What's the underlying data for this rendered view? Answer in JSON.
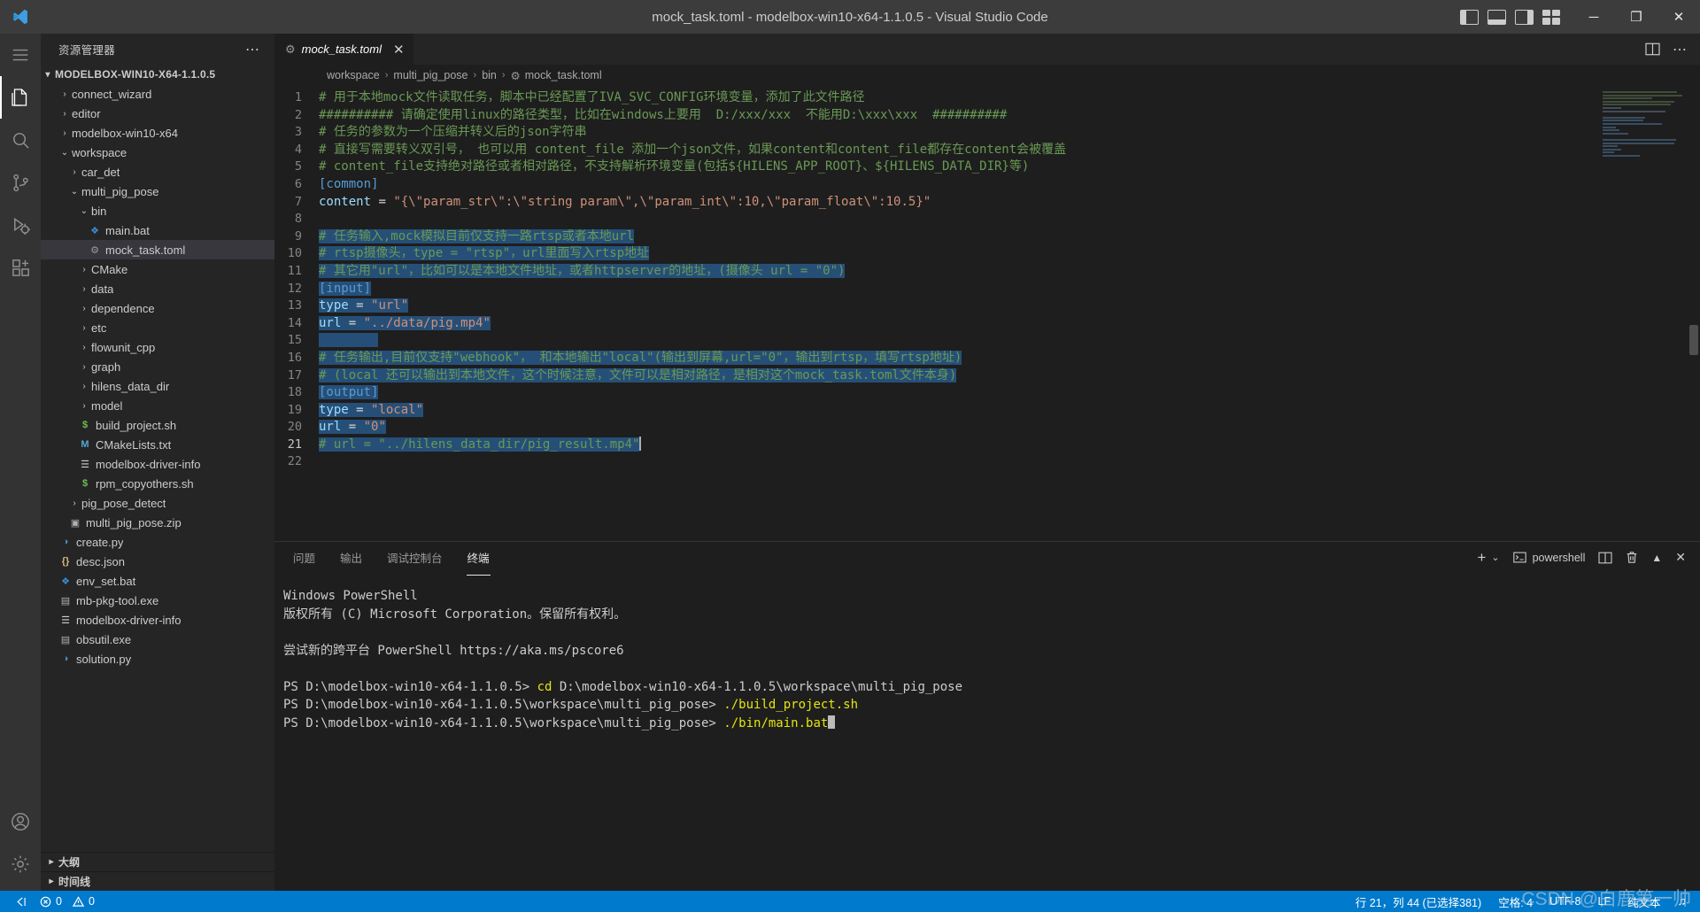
{
  "titlebar": {
    "title": "mock_task.toml - modelbox-win10-x64-1.1.0.5 - Visual Studio Code",
    "layout_icons": [
      "panel-left-icon",
      "panel-bottom-icon",
      "panel-right-icon",
      "customize-layout-icon"
    ],
    "window_buttons": {
      "minimize": "─",
      "maximize": "❐",
      "close": "✕"
    }
  },
  "activitybar": {
    "items": [
      {
        "name": "menu-icon",
        "label": "menu"
      },
      {
        "name": "explorer-icon",
        "label": "explorer"
      },
      {
        "name": "search-icon",
        "label": "search"
      },
      {
        "name": "source-control-icon",
        "label": "source-control"
      },
      {
        "name": "run-debug-icon",
        "label": "run-and-debug"
      },
      {
        "name": "extensions-icon",
        "label": "extensions"
      },
      {
        "name": "account-icon",
        "label": "accounts"
      },
      {
        "name": "settings-gear-icon",
        "label": "manage"
      }
    ]
  },
  "sidebar": {
    "header": "资源管理器",
    "more_actions": "⋯",
    "root": "MODELBOX-WIN10-X64-1.1.0.5",
    "tree": [
      {
        "label": "connect_wizard",
        "indent": 1,
        "type": "folder",
        "expanded": false
      },
      {
        "label": "editor",
        "indent": 1,
        "type": "folder",
        "expanded": false
      },
      {
        "label": "modelbox-win10-x64",
        "indent": 1,
        "type": "folder",
        "expanded": false
      },
      {
        "label": "workspace",
        "indent": 1,
        "type": "folder",
        "expanded": true
      },
      {
        "label": "car_det",
        "indent": 2,
        "type": "folder",
        "expanded": false
      },
      {
        "label": "multi_pig_pose",
        "indent": 2,
        "type": "folder",
        "expanded": true
      },
      {
        "label": "bin",
        "indent": 3,
        "type": "folder",
        "expanded": true
      },
      {
        "label": "main.bat",
        "indent": 4,
        "type": "file",
        "icon": "bat-icon"
      },
      {
        "label": "mock_task.toml",
        "indent": 4,
        "type": "file",
        "icon": "toml-gear-icon",
        "selected": true
      },
      {
        "label": "CMake",
        "indent": 3,
        "type": "folder",
        "expanded": false
      },
      {
        "label": "data",
        "indent": 3,
        "type": "folder",
        "expanded": false
      },
      {
        "label": "dependence",
        "indent": 3,
        "type": "folder",
        "expanded": false
      },
      {
        "label": "etc",
        "indent": 3,
        "type": "folder",
        "expanded": false
      },
      {
        "label": "flowunit_cpp",
        "indent": 3,
        "type": "folder",
        "expanded": false
      },
      {
        "label": "graph",
        "indent": 3,
        "type": "folder",
        "expanded": false
      },
      {
        "label": "hilens_data_dir",
        "indent": 3,
        "type": "folder",
        "expanded": false
      },
      {
        "label": "model",
        "indent": 3,
        "type": "folder",
        "expanded": false
      },
      {
        "label": "build_project.sh",
        "indent": 3,
        "type": "file",
        "icon": "shell-icon"
      },
      {
        "label": "CMakeLists.txt",
        "indent": 3,
        "type": "file",
        "icon": "cmake-icon"
      },
      {
        "label": "modelbox-driver-info",
        "indent": 3,
        "type": "file",
        "icon": "text-lines-icon"
      },
      {
        "label": "rpm_copyothers.sh",
        "indent": 3,
        "type": "file",
        "icon": "shell-icon"
      },
      {
        "label": "pig_pose_detect",
        "indent": 2,
        "type": "folder",
        "expanded": false
      },
      {
        "label": "multi_pig_pose.zip",
        "indent": 2,
        "type": "file",
        "icon": "zip-icon"
      },
      {
        "label": "create.py",
        "indent": 1,
        "type": "file",
        "icon": "python-icon"
      },
      {
        "label": "desc.json",
        "indent": 1,
        "type": "file",
        "icon": "json-icon"
      },
      {
        "label": "env_set.bat",
        "indent": 1,
        "type": "file",
        "icon": "bat-icon"
      },
      {
        "label": "mb-pkg-tool.exe",
        "indent": 1,
        "type": "file",
        "icon": "exe-icon"
      },
      {
        "label": "modelbox-driver-info",
        "indent": 1,
        "type": "file",
        "icon": "text-lines-icon"
      },
      {
        "label": "obsutil.exe",
        "indent": 1,
        "type": "file",
        "icon": "exe-icon"
      },
      {
        "label": "solution.py",
        "indent": 1,
        "type": "file",
        "icon": "python-icon"
      }
    ],
    "sections": [
      {
        "label": "大纲"
      },
      {
        "label": "时间线"
      }
    ]
  },
  "editor": {
    "tab": {
      "label": "mock_task.toml",
      "icon": "toml-gear-icon",
      "close": "✕",
      "dirty": false
    },
    "tab_actions": [
      "split-editor-icon",
      "more-actions-icon"
    ],
    "breadcrumb": [
      "workspace",
      "multi_pig_pose",
      "bin",
      "mock_task.toml"
    ],
    "breadcrumb_separator": "›",
    "lines": [
      {
        "n": "1",
        "text": "# 用于本地mock文件读取任务，脚本中已经配置了IVA_SVC_CONFIG环境变量，添加了此文件路径",
        "kind": "comment"
      },
      {
        "n": "2",
        "text": "########## 请确定使用linux的路径类型，比如在windows上要用  D:/xxx/xxx  不能用D:\\xxx\\xxx  ##########",
        "kind": "comment"
      },
      {
        "n": "3",
        "text": "# 任务的参数为一个压缩并转义后的json字符串",
        "kind": "comment"
      },
      {
        "n": "4",
        "text": "# 直接写需要转义双引号， 也可以用 content_file 添加一个json文件，如果content和content_file都存在content会被覆盖",
        "kind": "comment"
      },
      {
        "n": "5",
        "text": "# content_file支持绝对路径或者相对路径，不支持解析环境变量(包括${HILENS_APP_ROOT}、${HILENS_DATA_DIR}等)",
        "kind": "comment"
      },
      {
        "n": "6",
        "text": "[common]",
        "kind": "section"
      },
      {
        "n": "7",
        "text": "content = \"{\\\"param_str\\\":\\\"string param\\\",\\\"param_int\\\":10,\\\"param_float\\\":10.5}\"",
        "kind": "assign-str"
      },
      {
        "n": "8",
        "text": "",
        "kind": "blank"
      },
      {
        "n": "9",
        "text": "# 任务输入,mock模拟目前仅支持一路rtsp或者本地url",
        "kind": "comment",
        "selected": true
      },
      {
        "n": "10",
        "text": "# rtsp摄像头，type = \"rtsp\"，url里面写入rtsp地址",
        "kind": "comment",
        "selected": true
      },
      {
        "n": "11",
        "text": "# 其它用\"url\"，比如可以是本地文件地址，或者httpserver的地址，(摄像头 url = \"0\")",
        "kind": "comment",
        "selected": true
      },
      {
        "n": "12",
        "text": "[input]",
        "kind": "section",
        "selected": true
      },
      {
        "n": "13",
        "text": "type = \"url\"",
        "kind": "assign",
        "selected": true
      },
      {
        "n": "14",
        "text": "url = \"../data/pig.mp4\"",
        "kind": "assign",
        "selected": true
      },
      {
        "n": "15",
        "text": "",
        "kind": "blank",
        "selected": true
      },
      {
        "n": "16",
        "text": "# 任务输出,目前仅支持\"webhook\"， 和本地输出\"local\"(输出到屏幕,url=\"0\"，输出到rtsp，填写rtsp地址)",
        "kind": "comment",
        "selected": true
      },
      {
        "n": "17",
        "text": "# (local 还可以输出到本地文件，这个时候注意，文件可以是相对路径，是相对这个mock_task.toml文件本身)",
        "kind": "comment",
        "selected": true
      },
      {
        "n": "18",
        "text": "[output]",
        "kind": "section",
        "selected": true
      },
      {
        "n": "19",
        "text": "type = \"local\"",
        "kind": "assign",
        "selected": true
      },
      {
        "n": "20",
        "text": "url = \"0\"",
        "kind": "assign",
        "selected": true
      },
      {
        "n": "21",
        "text": "# url = \"../hilens_data_dir/pig_result.mp4\"",
        "kind": "comment",
        "selected": true,
        "cursor": true
      },
      {
        "n": "22",
        "text": "",
        "kind": "blank"
      }
    ]
  },
  "panel": {
    "tabs": [
      {
        "label": "问题",
        "active": false
      },
      {
        "label": "输出",
        "active": false
      },
      {
        "label": "调试控制台",
        "active": false
      },
      {
        "label": "终端",
        "active": true
      }
    ],
    "actions": {
      "new_terminal": "+",
      "chevron": "⌄",
      "terminal_name": "powershell",
      "split": "split-terminal-icon",
      "kill": "trash-icon",
      "maximize": "chevron-up-icon",
      "close": "✕"
    },
    "terminal_lines": [
      {
        "segments": [
          {
            "t": "Windows PowerShell"
          }
        ]
      },
      {
        "segments": [
          {
            "t": "版权所有 (C) Microsoft Corporation。保留所有权利。"
          }
        ]
      },
      {
        "segments": [
          {
            "t": ""
          }
        ]
      },
      {
        "segments": [
          {
            "t": "尝试新的跨平台 PowerShell https://aka.ms/pscore6"
          }
        ]
      },
      {
        "segments": [
          {
            "t": ""
          }
        ]
      },
      {
        "segments": [
          {
            "t": "PS D:\\modelbox-win10-x64-1.1.0.5> "
          },
          {
            "t": "cd",
            "c": "yellow"
          },
          {
            "t": " D:\\modelbox-win10-x64-1.1.0.5\\workspace\\multi_pig_pose"
          }
        ]
      },
      {
        "segments": [
          {
            "t": "PS D:\\modelbox-win10-x64-1.1.0.5\\workspace\\multi_pig_pose> "
          },
          {
            "t": "./build_project.sh",
            "c": "yellow"
          }
        ]
      },
      {
        "segments": [
          {
            "t": "PS D:\\modelbox-win10-x64-1.1.0.5\\workspace\\multi_pig_pose> "
          },
          {
            "t": "./bin/main.bat",
            "c": "yellow"
          },
          {
            "t": "",
            "cursor": true
          }
        ]
      }
    ]
  },
  "statusbar": {
    "errors": "0",
    "warnings": "0",
    "remote_icon": "remote-window-icon",
    "cursor_position": "行 21，列 44 (已选择381)",
    "indentation": "空格: 4",
    "encoding": "UTF-8",
    "eol": "LF",
    "language": "纯文本",
    "bell": "♫",
    "watermark": "CSDN @白鹿第一帅"
  },
  "colors": {
    "accent": "#007acc",
    "selection": "#264f78",
    "comment": "#6a9955",
    "string": "#ce9178",
    "section": "#569cd6",
    "key": "#9cdcfe",
    "number": "#b5cea8",
    "terminal_yellow": "#e5e510"
  }
}
